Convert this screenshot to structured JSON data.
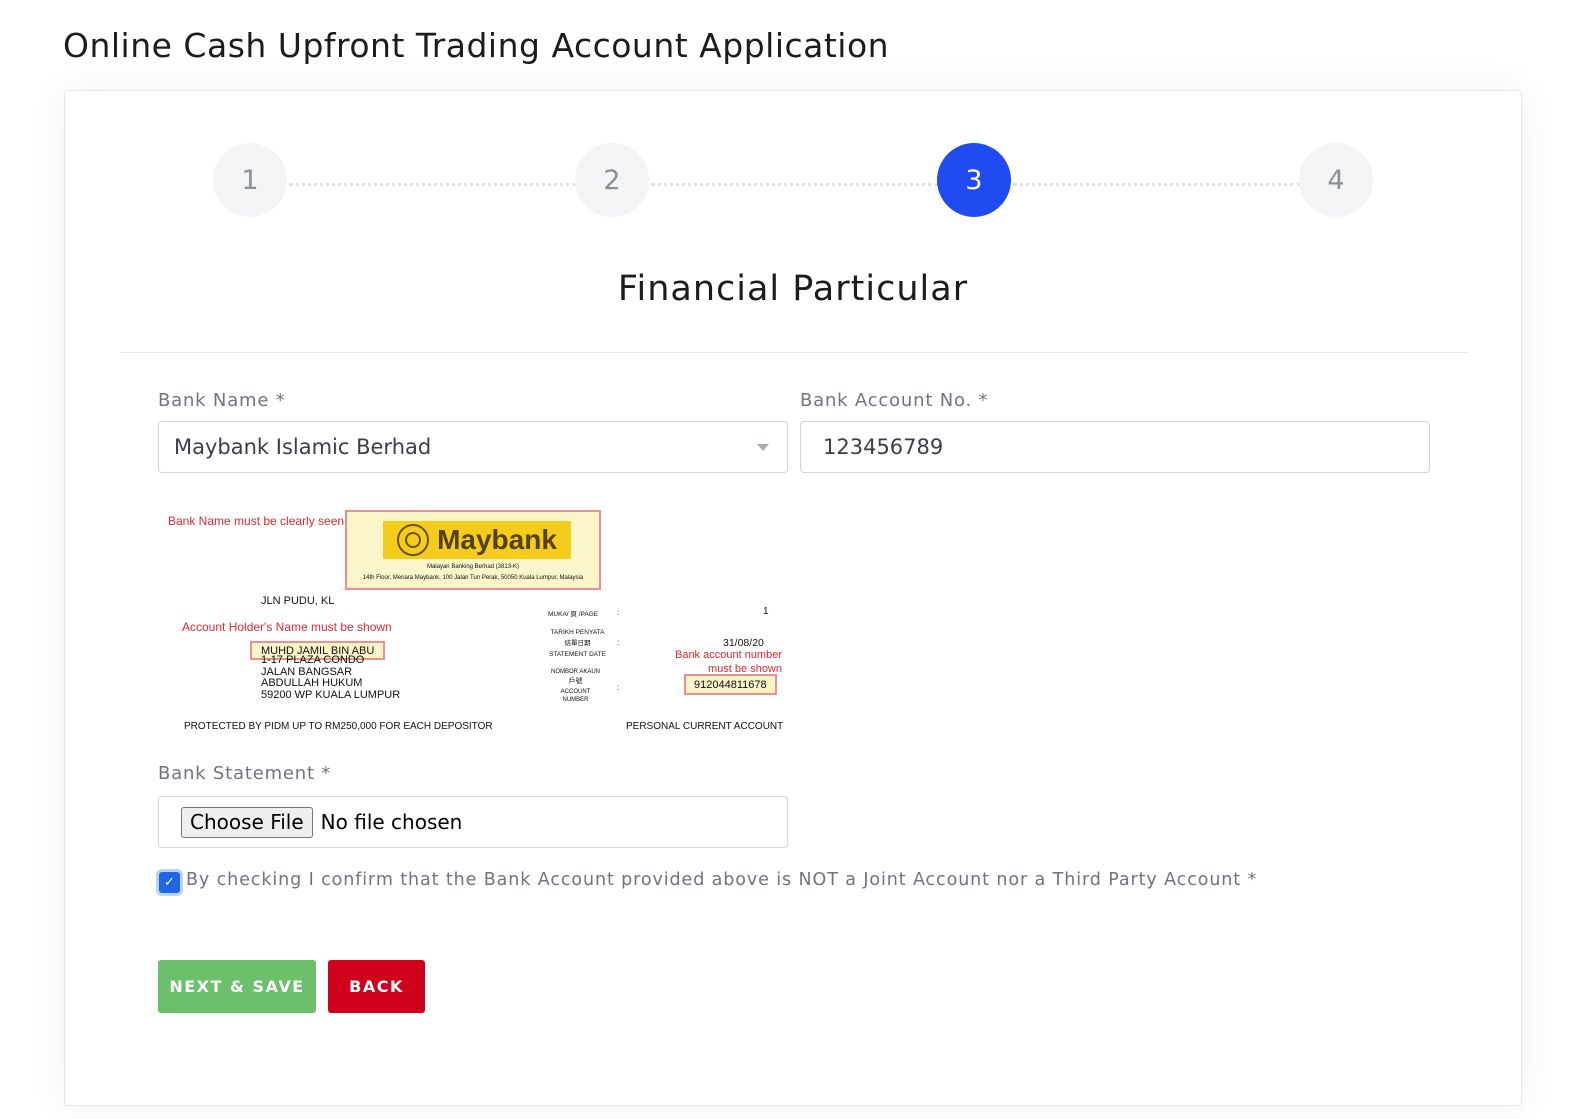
{
  "page_title": "Online Cash Upfront Trading Account Application",
  "stepper": {
    "steps": [
      "1",
      "2",
      "3",
      "4"
    ],
    "active": "3",
    "active_color": "#1f4bf0"
  },
  "section_title": "Financial Particular",
  "bank_name": {
    "label": "Bank Name *",
    "value": "Maybank Islamic Berhad"
  },
  "bank_account": {
    "label": "Bank Account No. *",
    "value": "123456789"
  },
  "sample_statement": {
    "bank_name_note": "Bank Name must be clearly seen",
    "bank_brand": "Maybank",
    "bank_reg": "Malayan Banking Berhad (3813-K)",
    "bank_address": "14th Floor, Menara Maybank, 100 Jalan Tun Perak, 50050 Kuala Lumpur, Malaysia",
    "branch": "JLN PUDU, KL",
    "holder_note": "Account Holder's Name must be shown",
    "holder_name": "MUHD JAMIL BIN ABU",
    "address_lines": [
      "1-17 PLAZA CONDO",
      "JALAN BANGSAR",
      "ABDULLAH HUKUM",
      "59200 WP KUALA LUMPUR"
    ],
    "page_label": "MUKA/ 頁 /PAGE",
    "page_value": "1",
    "date_label_1": "TARIKH PENYATA",
    "date_label_2": "結單日期",
    "date_label_3": "STATEMENT DATE",
    "date_value": "31/08/20",
    "acct_label_1": "NOMBOR AKAUN",
    "acct_label_2": "戶號",
    "acct_label_3": "ACCOUNT",
    "acct_label_4": "NUMBER",
    "acct_note_1": "Bank account number",
    "acct_note_2": "must be shown",
    "acct_value": "912044811678",
    "pidm": "PROTECTED BY PIDM UP TO RM250,000 FOR EACH DEPOSITOR",
    "acct_type": "PERSONAL CURRENT ACCOUNT",
    "colon": ":"
  },
  "bank_statement": {
    "label": "Bank Statement *",
    "button": "Choose File",
    "status": "No file chosen"
  },
  "confirm": {
    "checked": true,
    "label": "By checking I confirm that the Bank Account provided above is NOT a Joint Account nor a Third Party Account *"
  },
  "buttons": {
    "next": "NEXT & SAVE",
    "back": "BACK",
    "next_color": "#6cc06b",
    "back_color": "#d0021b"
  }
}
